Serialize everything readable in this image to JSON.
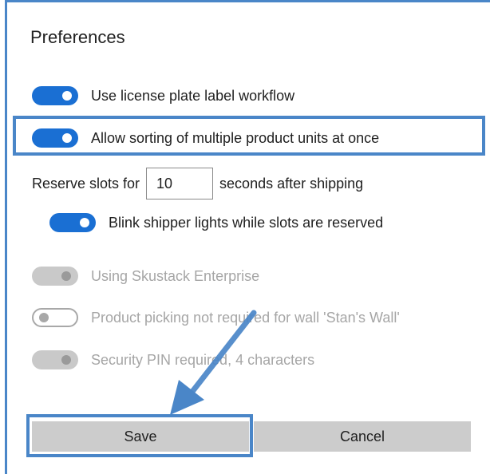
{
  "dialog": {
    "title": "Preferences"
  },
  "toggles": [
    {
      "label": "Use license plate label workflow",
      "state": "on"
    },
    {
      "label": "Allow sorting of multiple product units at once",
      "state": "on"
    }
  ],
  "reserve": {
    "prefix": "Reserve slots for",
    "value": "10",
    "suffix": "seconds after shipping"
  },
  "blink_toggle": {
    "label": "Blink shipper lights while slots are reserved",
    "state": "on"
  },
  "disabled_toggles": [
    {
      "label": "Using Skustack Enterprise",
      "state": "on"
    },
    {
      "label": "Product picking not required for wall 'Stan's Wall'",
      "state": "off"
    },
    {
      "label": "Security PIN required, 4 characters",
      "state": "on"
    }
  ],
  "buttons": {
    "save": "Save",
    "cancel": "Cancel"
  },
  "colors": {
    "accent": "#1a6fd3",
    "annotation": "#4a86c8",
    "button_bg": "#cccccc",
    "disabled_text": "#a6a6a6"
  }
}
